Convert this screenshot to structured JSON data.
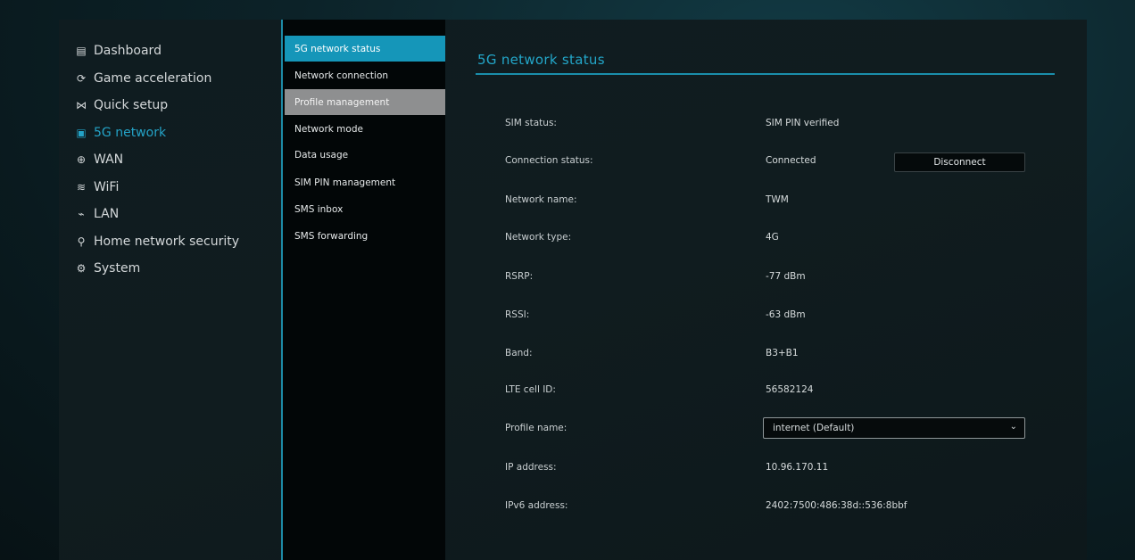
{
  "sidebar": {
    "items": [
      {
        "label": "Dashboard",
        "icon": "▤"
      },
      {
        "label": "Game acceleration",
        "icon": "⟳"
      },
      {
        "label": "Quick setup",
        "icon": "⋈"
      },
      {
        "label": "5G network",
        "icon": "▣"
      },
      {
        "label": "WAN",
        "icon": "⊕"
      },
      {
        "label": "WiFi",
        "icon": "≋"
      },
      {
        "label": "LAN",
        "icon": "⌁"
      },
      {
        "label": "Home network security",
        "icon": "⚲"
      },
      {
        "label": "System",
        "icon": "⚙"
      }
    ],
    "active_label": "5G network"
  },
  "submenu": {
    "items": [
      {
        "label": "5G network status"
      },
      {
        "label": "Network connection"
      },
      {
        "label": "Profile management"
      },
      {
        "label": "Network mode"
      },
      {
        "label": "Data usage"
      },
      {
        "label": "SIM PIN management"
      },
      {
        "label": "SMS inbox"
      },
      {
        "label": "SMS forwarding"
      }
    ],
    "active_label": "5G network status",
    "hover_label": "Profile management"
  },
  "content": {
    "title": "5G network status",
    "rows": [
      {
        "label": "SIM status:",
        "value": "SIM PIN verified"
      },
      {
        "label": "Connection status:",
        "value": "Connected"
      },
      {
        "label": "Network name:",
        "value": "TWM"
      },
      {
        "label": "Network type:",
        "value": "4G"
      },
      {
        "label": "RSRP:",
        "value": "-77 dBm"
      },
      {
        "label": "RSSI:",
        "value": "-63 dBm"
      },
      {
        "label": "Band:",
        "value": "B3+B1"
      },
      {
        "label": "LTE cell ID:",
        "value": "56582124"
      },
      {
        "label": "Profile name:",
        "value": ""
      },
      {
        "label": "IP address:",
        "value": "10.96.170.11"
      },
      {
        "label": "IPv6 address:",
        "value": "2402:7500:486:38d::536:8bbf"
      }
    ],
    "disconnect_label": "Disconnect",
    "profile_select_value": "internet (Default)"
  },
  "colors": {
    "accent": "#1596b9",
    "accent_text": "#24a3c7",
    "hover_gray": "#8e8f90"
  }
}
